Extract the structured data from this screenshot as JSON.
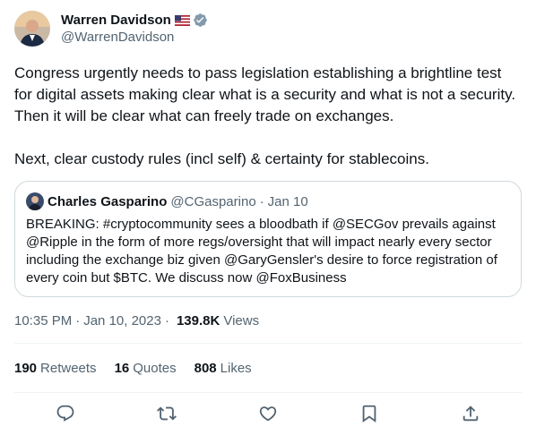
{
  "author": {
    "display_name": "Warren Davidson",
    "handle": "@WarrenDavidson",
    "verified_color": "#829aab",
    "flag_icon": "us-flag-icon"
  },
  "tweet": {
    "text": "Congress urgently needs to pass legislation establishing a brightline test for digital assets making clear what is a security and what is not a security. Then it will be clear what can freely trade on exchanges.\n\nNext, clear custody rules (incl self) & certainty for stablecoins."
  },
  "quote": {
    "name": "Charles Gasparino",
    "handle": "@CGasparino",
    "separator": "·",
    "date": "Jan 10",
    "text": "BREAKING: #cryptocommunity sees a bloodbath if @SECGov prevails against @Ripple in the form of more regs/oversight that will impact nearly every sector including the exchange biz given @GaryGensler's desire to force registration of every coin but $BTC. We discuss now @FoxBusiness"
  },
  "meta": {
    "time": "10:35 PM",
    "separator": "·",
    "date": "Jan 10, 2023",
    "views_count": "139.8K",
    "views_label": "Views"
  },
  "stats": {
    "retweets_count": "190",
    "retweets_label": "Retweets",
    "quotes_count": "16",
    "quotes_label": "Quotes",
    "likes_count": "808",
    "likes_label": "Likes"
  },
  "actions": [
    "reply-icon",
    "retweet-icon",
    "like-icon",
    "bookmark-icon",
    "share-icon"
  ],
  "colors": {
    "text_primary": "#0f1419",
    "text_secondary": "#536471",
    "border": "#cfd9de",
    "divider": "#eff3f4"
  }
}
